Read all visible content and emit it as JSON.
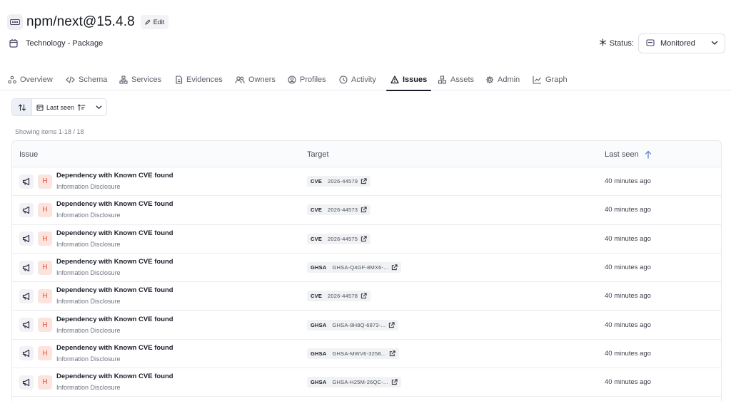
{
  "header": {
    "title": "npm/next@15.4.8",
    "edit_label": "Edit",
    "subtitle": "Technology - Package",
    "status_label": "Status:",
    "status_value": "Monitored"
  },
  "tabs": [
    {
      "label": "Overview",
      "icon": "overview-icon",
      "active": false
    },
    {
      "label": "Schema",
      "icon": "code-icon",
      "active": false
    },
    {
      "label": "Services",
      "icon": "services-icon",
      "active": false
    },
    {
      "label": "Evidences",
      "icon": "file-icon",
      "active": false
    },
    {
      "label": "Owners",
      "icon": "users-icon",
      "active": false
    },
    {
      "label": "Profiles",
      "icon": "user-circle-icon",
      "active": false
    },
    {
      "label": "Activity",
      "icon": "clock-icon",
      "active": false
    },
    {
      "label": "Issues",
      "icon": "warning-icon",
      "active": true
    },
    {
      "label": "Assets",
      "icon": "boxes-icon",
      "active": false
    },
    {
      "label": "Admin",
      "icon": "gear-icon",
      "active": false
    },
    {
      "label": "Graph",
      "icon": "chart-line-icon",
      "active": false
    }
  ],
  "sort": {
    "field_label": "Last seen"
  },
  "showing": "Showing items 1-18 / 18",
  "table": {
    "columns": [
      "Issue",
      "Target",
      "Last seen"
    ],
    "rows": [
      {
        "title": "Dependency with Known CVE found",
        "category": "Information Disclosure",
        "severity": "H",
        "tag": "CVE",
        "id": "2026-44579",
        "seen": "40 minutes ago"
      },
      {
        "title": "Dependency with Known CVE found",
        "category": "Information Disclosure",
        "severity": "H",
        "tag": "CVE",
        "id": "2026-44573",
        "seen": "40 minutes ago"
      },
      {
        "title": "Dependency with Known CVE found",
        "category": "Information Disclosure",
        "severity": "H",
        "tag": "CVE",
        "id": "2026-44575",
        "seen": "40 minutes ago"
      },
      {
        "title": "Dependency with Known CVE found",
        "category": "Information Disclosure",
        "severity": "H",
        "tag": "GHSA",
        "id": "GHSA-Q4GF-8MX6-...",
        "seen": "40 minutes ago"
      },
      {
        "title": "Dependency with Known CVE found",
        "category": "Information Disclosure",
        "severity": "H",
        "tag": "CVE",
        "id": "2026-44578",
        "seen": "40 minutes ago"
      },
      {
        "title": "Dependency with Known CVE found",
        "category": "Information Disclosure",
        "severity": "H",
        "tag": "GHSA",
        "id": "GHSA-8H8Q-6873-...",
        "seen": "40 minutes ago"
      },
      {
        "title": "Dependency with Known CVE found",
        "category": "Information Disclosure",
        "severity": "H",
        "tag": "GHSA",
        "id": "GHSA-MWV6-3258...",
        "seen": "40 minutes ago"
      },
      {
        "title": "Dependency with Known CVE found",
        "category": "Information Disclosure",
        "severity": "H",
        "tag": "GHSA",
        "id": "GHSA-H25M-26QC-...",
        "seen": "40 minutes ago"
      }
    ]
  }
}
